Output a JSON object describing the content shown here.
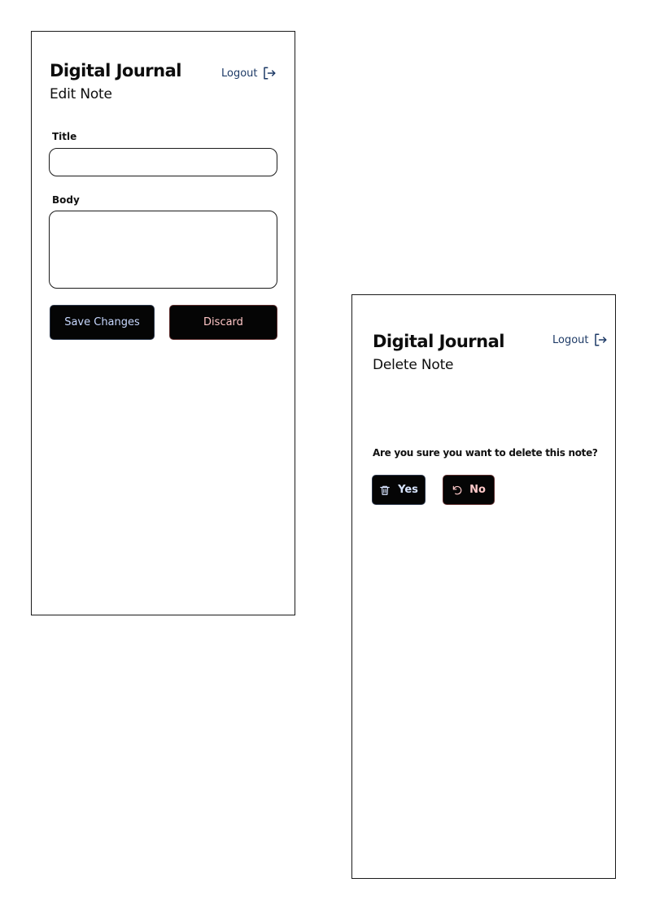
{
  "edit_screen": {
    "app_title": "Digital Journal",
    "page_title": "Edit Note",
    "logout_label": "Logout",
    "form": {
      "title_label": "Title",
      "title_value": "",
      "body_label": "Body",
      "body_value": ""
    },
    "buttons": {
      "save_label": "Save Changes",
      "discard_label": "Discard"
    }
  },
  "delete_screen": {
    "app_title": "Digital Journal",
    "page_title": "Delete Note",
    "logout_label": "Logout",
    "confirm_message": "Are you sure you want to delete this note?",
    "buttons": {
      "yes_label": "Yes",
      "no_label": "No"
    }
  },
  "icons": {
    "logout": "logout-icon",
    "yes": "trash-icon",
    "no": "undo-icon"
  },
  "colors": {
    "logout_text": "#1d3a66",
    "button_bg": "#050505",
    "save_text": "#c8d8ff",
    "discard_text": "#ffc6c6",
    "yes_text": "#d7e4ff",
    "no_text": "#ffcaca"
  }
}
